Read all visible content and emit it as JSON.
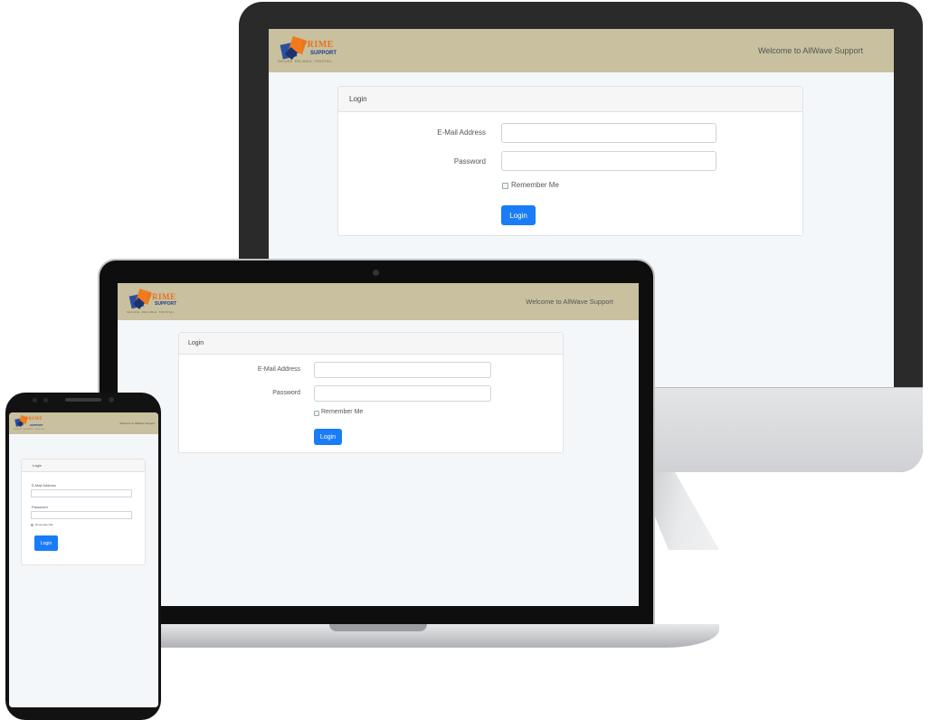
{
  "app": {
    "logo": {
      "word_prime": "PRIME",
      "word_support": "SUPPORT",
      "tagline": "SECURE. RELIABLE. TRUSTED."
    },
    "header": {
      "welcome": "Welcome to AllWave Support"
    },
    "login_card": {
      "title": "Login",
      "email_label": "E-Mail Address",
      "email_value": "",
      "password_label": "Password",
      "password_value": "",
      "remember_label": "Remember Me",
      "remember_checked": false,
      "submit_label": "Login"
    }
  },
  "colors": {
    "header_bg": "#c8c09e",
    "page_bg": "#f4f7fa",
    "button_primary": "#1a7cf7",
    "logo_orange": "#e8711c",
    "logo_blue": "#1f3d8a"
  }
}
